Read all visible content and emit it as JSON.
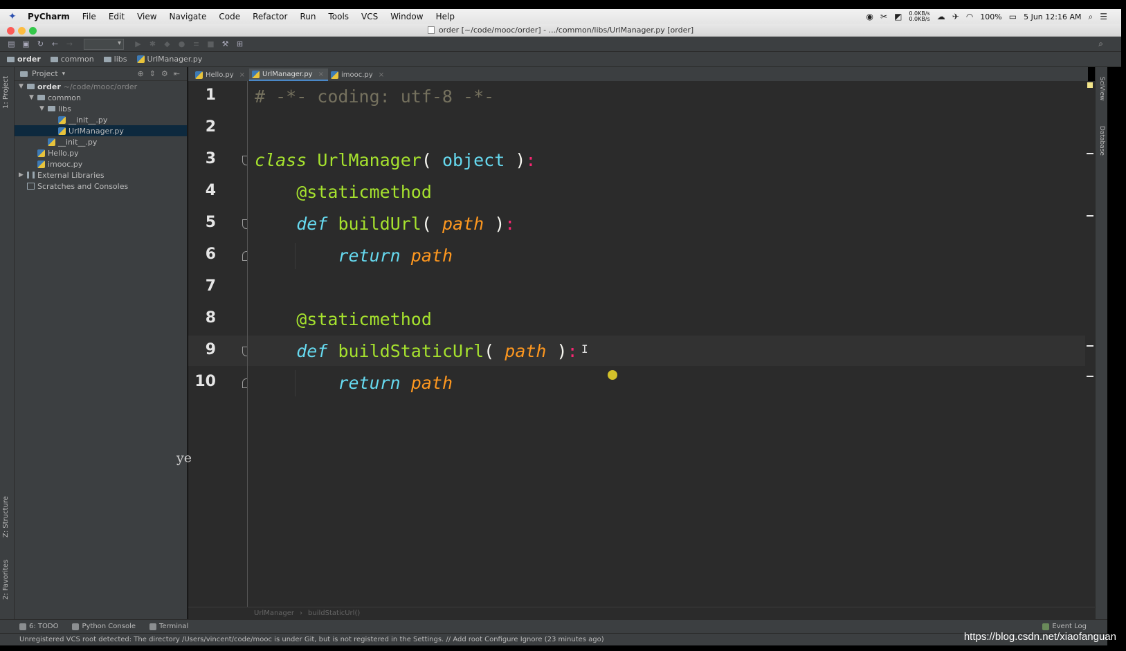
{
  "menubar": {
    "app_name": "PyCharm",
    "items": [
      "File",
      "Edit",
      "View",
      "Navigate",
      "Code",
      "Refactor",
      "Run",
      "Tools",
      "VCS",
      "Window",
      "Help"
    ],
    "net_up": "0.0KB/s",
    "net_down": "0.0KB/s",
    "battery": "100%",
    "datetime": "5 Jun 12:16 AM"
  },
  "window": {
    "title": "order [~/code/mooc/order] - .../common/libs/UrlManager.py [order]"
  },
  "navbar": {
    "crumbs": [
      "order",
      "common",
      "libs",
      "UrlManager.py"
    ]
  },
  "left_strip": {
    "project_tab": "1: Project",
    "structure_tab": "Z: Structure",
    "favorites_tab": "2: Favorites"
  },
  "right_strip": {
    "sciview_tab": "SciView",
    "database_tab": "Database"
  },
  "project": {
    "header": "Project",
    "tree": [
      {
        "label": "order",
        "hint": "~/code/mooc/order",
        "indent": 0,
        "kind": "folder",
        "open": true,
        "bold": true
      },
      {
        "label": "common",
        "hint": "",
        "indent": 1,
        "kind": "folder",
        "open": true,
        "bold": false
      },
      {
        "label": "libs",
        "hint": "",
        "indent": 2,
        "kind": "folder",
        "open": true,
        "bold": false
      },
      {
        "label": "__init__.py",
        "hint": "",
        "indent": 3,
        "kind": "py",
        "open": false,
        "bold": false
      },
      {
        "label": "UrlManager.py",
        "hint": "",
        "indent": 3,
        "kind": "py",
        "open": false,
        "bold": false,
        "selected": true
      },
      {
        "label": "__init__.py",
        "hint": "",
        "indent": 2,
        "kind": "py",
        "open": false,
        "bold": false
      },
      {
        "label": "Hello.py",
        "hint": "",
        "indent": 1,
        "kind": "py",
        "open": false,
        "bold": false
      },
      {
        "label": "imooc.py",
        "hint": "",
        "indent": 1,
        "kind": "py",
        "open": false,
        "bold": false
      },
      {
        "label": "External Libraries",
        "hint": "",
        "indent": 0,
        "kind": "lib",
        "open": false,
        "bold": false,
        "collapsed": true
      },
      {
        "label": "Scratches and Consoles",
        "hint": "",
        "indent": 0,
        "kind": "scratch",
        "open": false,
        "bold": false
      }
    ]
  },
  "tabs": [
    {
      "label": "Hello.py",
      "active": false
    },
    {
      "label": "UrlManager.py",
      "active": true
    },
    {
      "label": "imooc.py",
      "active": false
    }
  ],
  "editor": {
    "current_line": 9,
    "lines": [
      {
        "n": "1",
        "tokens": [
          {
            "t": "# -*- coding: utf-8 -*-",
            "c": "comment"
          }
        ]
      },
      {
        "n": "2",
        "tokens": []
      },
      {
        "n": "3",
        "tokens": [
          {
            "t": "class",
            "c": "kw"
          },
          {
            "t": " ",
            "c": "punc"
          },
          {
            "t": "UrlManager",
            "c": "cls"
          },
          {
            "t": "( ",
            "c": "punc"
          },
          {
            "t": "object",
            "c": "builtin"
          },
          {
            "t": " )",
            "c": "punc"
          },
          {
            "t": ":",
            "c": "colon"
          }
        ]
      },
      {
        "n": "4",
        "tokens": [
          {
            "t": "    ",
            "c": "punc"
          },
          {
            "t": "@staticmethod",
            "c": "deco"
          }
        ]
      },
      {
        "n": "5",
        "tokens": [
          {
            "t": "    ",
            "c": "punc"
          },
          {
            "t": "def",
            "c": "kw2"
          },
          {
            "t": " ",
            "c": "punc"
          },
          {
            "t": "buildUrl",
            "c": "cls"
          },
          {
            "t": "( ",
            "c": "punc"
          },
          {
            "t": "path",
            "c": "param"
          },
          {
            "t": " )",
            "c": "punc"
          },
          {
            "t": ":",
            "c": "colon"
          }
        ]
      },
      {
        "n": "6",
        "tokens": [
          {
            "t": "        ",
            "c": "punc"
          },
          {
            "t": "return",
            "c": "kw2"
          },
          {
            "t": " ",
            "c": "punc"
          },
          {
            "t": "path",
            "c": "param"
          }
        ]
      },
      {
        "n": "7",
        "tokens": []
      },
      {
        "n": "8",
        "tokens": [
          {
            "t": "    ",
            "c": "punc"
          },
          {
            "t": "@staticmethod",
            "c": "deco"
          }
        ]
      },
      {
        "n": "9",
        "tokens": [
          {
            "t": "    ",
            "c": "punc"
          },
          {
            "t": "def",
            "c": "kw2"
          },
          {
            "t": " ",
            "c": "punc"
          },
          {
            "t": "buildStaticUrl",
            "c": "cls"
          },
          {
            "t": "( ",
            "c": "punc"
          },
          {
            "t": "path",
            "c": "param"
          },
          {
            "t": " )",
            "c": "punc"
          },
          {
            "t": ":",
            "c": "colon"
          }
        ]
      },
      {
        "n": "10",
        "tokens": [
          {
            "t": "        ",
            "c": "punc"
          },
          {
            "t": "return",
            "c": "kw2"
          },
          {
            "t": " ",
            "c": "punc"
          },
          {
            "t": "path",
            "c": "param"
          }
        ]
      }
    ],
    "fold_lines": [
      3,
      5,
      6,
      9,
      10
    ],
    "fold_ends": [
      6,
      10
    ],
    "bulb_line": 9,
    "caret_glyph": "I"
  },
  "side_note": "ye",
  "editor_breadcrumb": [
    "UrlManager",
    "buildStaticUrl()"
  ],
  "bottom_tabs": {
    "todo": "6: TODO",
    "python_console": "Python Console",
    "terminal": "Terminal",
    "event_log": "Event Log"
  },
  "status": {
    "message": "Unregistered VCS root detected: The directory /Users/vincent/code/mooc is under Git, but is not registered in the Settings. // Add root  Configure  Ignore (23 minutes ago)"
  },
  "watermark": "https://blog.csdn.net/xiaofanguan",
  "colors": {
    "editor_bg": "#2b2b2b",
    "panel_bg": "#3c3f41",
    "selection": "#0d293e",
    "keyword": "#a6e22e",
    "param": "#fd971f"
  }
}
